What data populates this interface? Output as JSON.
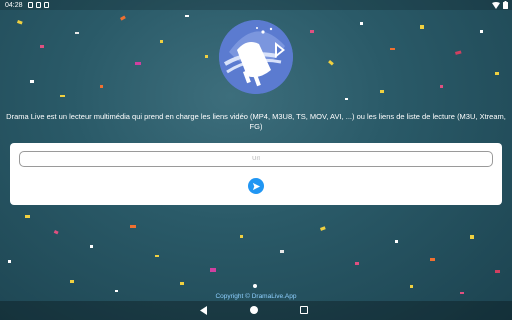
{
  "status_bar": {
    "time": "04:28",
    "left_icons": [
      "notification-icon",
      "notification-icon",
      "notification-icon"
    ],
    "right_icons": [
      "wifi-icon",
      "battery-icon"
    ]
  },
  "app": {
    "description": "Drama Live est un lecteur multimédia qui prend en charge les liens vidéo (MP4, M3U8, TS, MOV, AVI, ...) ou les liens de liste de lecture (M3U, Xtream, FG)",
    "url_placeholder": "Url",
    "send_icon": "send-icon",
    "copyright": "Copyright © DramaLive.App"
  },
  "colors": {
    "accent": "#2196f3",
    "logo_background": "#5b7bd0",
    "copyright_link": "#8fd0ff"
  },
  "nav_bar": {
    "icons": [
      "back-icon",
      "home-icon",
      "recents-icon"
    ]
  }
}
